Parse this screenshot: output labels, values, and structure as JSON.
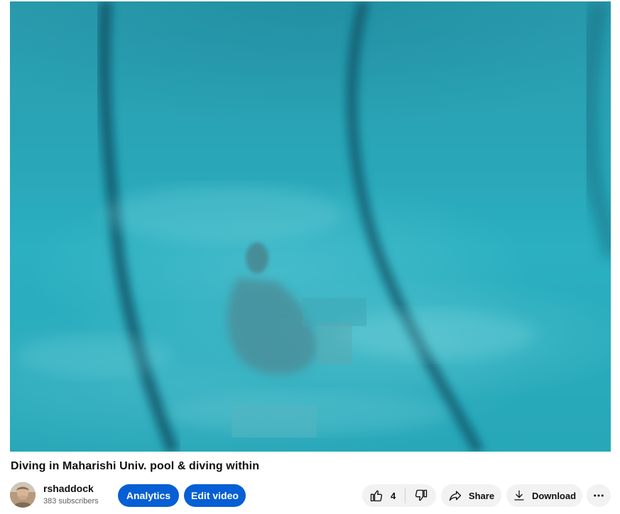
{
  "video": {
    "title": "Diving in Maharishi Univ. pool & diving within"
  },
  "channel": {
    "name": "rshaddock",
    "subscribers": "383 subscribers"
  },
  "owner_actions": {
    "analytics_label": "Analytics",
    "edit_label": "Edit video"
  },
  "actions": {
    "like_count": "4",
    "share_label": "Share",
    "download_label": "Download"
  },
  "icons": {
    "like": "thumbs-up-icon",
    "dislike": "thumbs-down-icon",
    "share": "share-arrow-icon",
    "download": "download-icon",
    "more": "more-horizontal-icon"
  },
  "colors": {
    "primary_blue": "#065fd4",
    "button_gray": "#f2f2f2",
    "text": "#0f0f0f",
    "secondary_text": "#606060",
    "water": "#29a6b8"
  }
}
